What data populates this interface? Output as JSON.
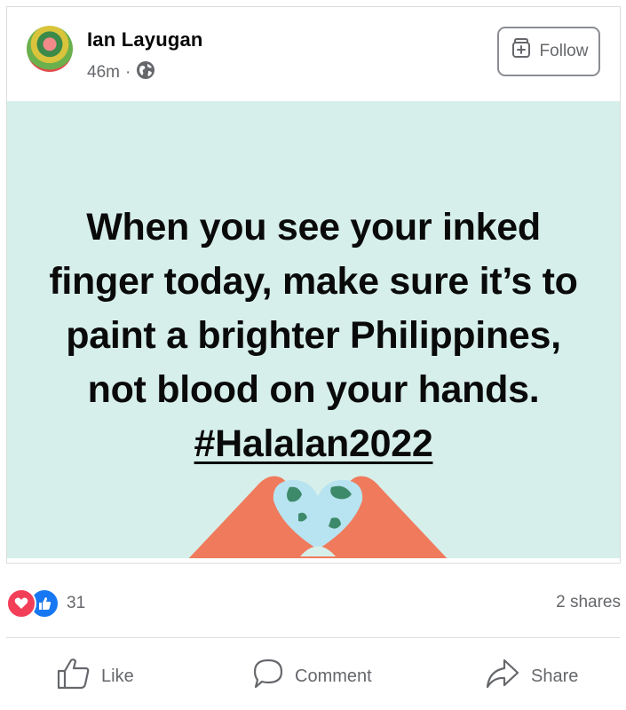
{
  "post": {
    "author_name": "Ian Layugan",
    "timestamp": "46m",
    "separator": "·",
    "privacy_icon": "globe-icon",
    "follow_label": "Follow",
    "quote_text": "When you see your inked finger today, make sure it’s to paint a brighter Philippines, not blood on your hands.",
    "hashtag": "#Halalan2022",
    "banner_color": "#d6efea"
  },
  "stats": {
    "reaction_icons": [
      "love-reaction-icon",
      "like-reaction-icon"
    ],
    "reaction_count": "31",
    "shares": "2 shares"
  },
  "actions": {
    "like_label": "Like",
    "comment_label": "Comment",
    "share_label": "Share"
  },
  "colors": {
    "love": "#f33e58",
    "like": "#1877f2",
    "muted": "#65676b",
    "hands": "#f07a5c"
  }
}
